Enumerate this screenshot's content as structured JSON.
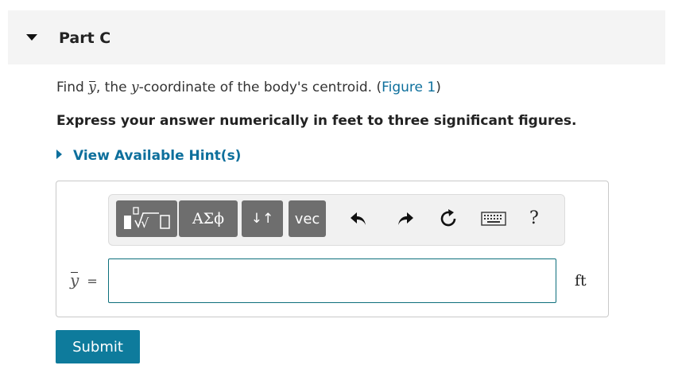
{
  "part": {
    "title": "Part C"
  },
  "question": {
    "prefix": "Find ",
    "var_symbol": "y",
    "middle": ", the ",
    "coord_symbol": "y",
    "suffix": "-coordinate of the body's centroid. (",
    "figure_link": "Figure 1",
    "close": ")"
  },
  "instruction": "Express your answer numerically in feet to three significant figures.",
  "hint": {
    "label": "View Available Hint(s)"
  },
  "toolbar": {
    "template_icon": "templates-icon",
    "greek_label": "ΑΣϕ",
    "arrows_label": "↓↑",
    "vec_label": "vec",
    "undo_icon": "undo-icon",
    "redo_icon": "redo-icon",
    "reset_icon": "reset-icon",
    "keyboard_icon": "keyboard-icon",
    "help_label": "?"
  },
  "answer": {
    "variable": "y",
    "equals": "=",
    "value": "",
    "unit": "ft"
  },
  "submit_label": "Submit",
  "colors": {
    "accent": "#0e7b9c",
    "link": "#0d6f9c",
    "button_gray": "#6e6e6e"
  }
}
